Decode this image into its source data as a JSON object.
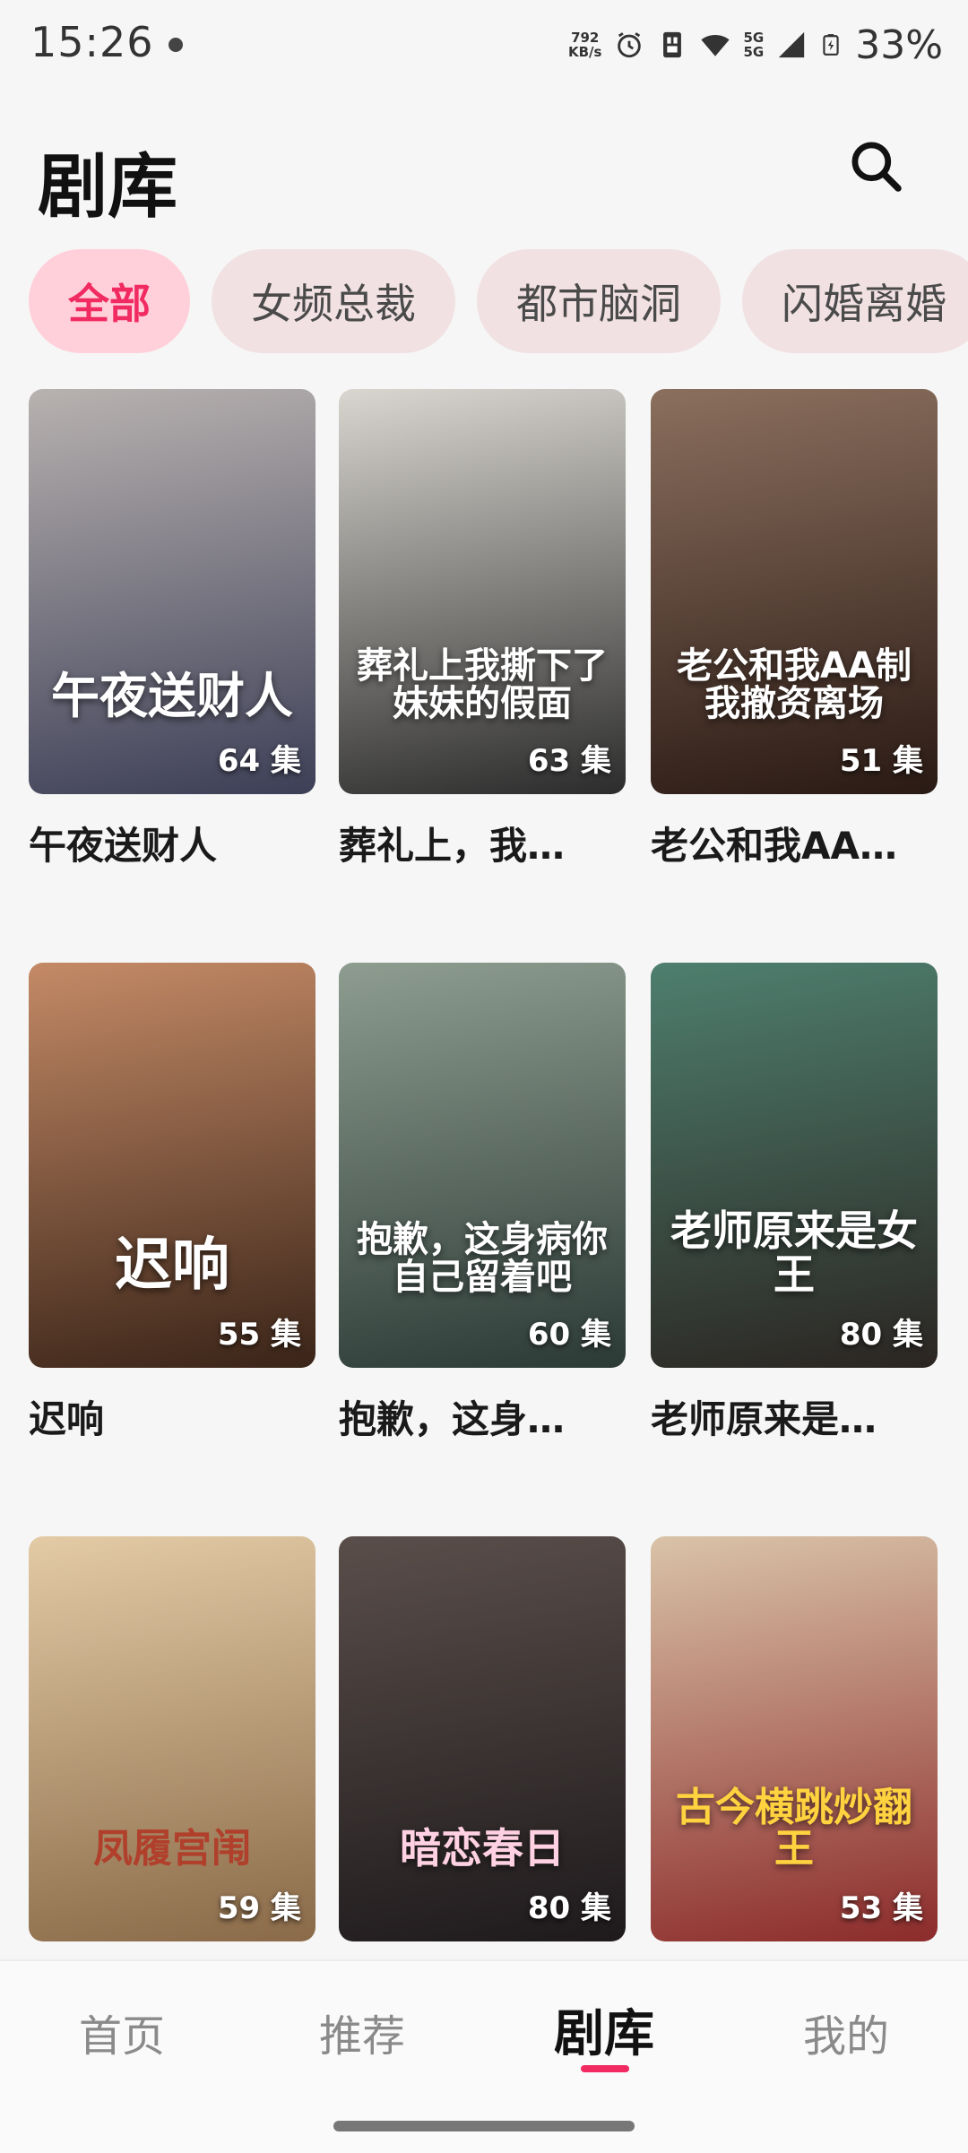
{
  "status_bar": {
    "time": "15:26",
    "net_speed": "792",
    "net_unit": "KB/s",
    "network": "5G",
    "battery": "33%"
  },
  "header": {
    "title": "剧库",
    "search_icon": "search-icon"
  },
  "chips": [
    {
      "label": "全部",
      "active": true
    },
    {
      "label": "女频总裁",
      "active": false
    },
    {
      "label": "都市脑洞",
      "active": false
    },
    {
      "label": "闪婚离婚",
      "active": false
    }
  ],
  "dramas": [
    {
      "title": "午夜送财人",
      "poster_text": "午夜送财人",
      "episodes": "64 集",
      "colors": [
        "#b8b2b0",
        "#3d3f57"
      ]
    },
    {
      "title": "葬礼上，我…",
      "poster_text": "葬礼上我撕下了妹妹的假面",
      "episodes": "63 集",
      "colors": [
        "#d9d6d0",
        "#2c2c2c"
      ]
    },
    {
      "title": "老公和我AA…",
      "poster_text": "老公和我AA制 我撤资离场",
      "episodes": "51 集",
      "colors": [
        "#8b6f5e",
        "#2a1a14"
      ]
    },
    {
      "title": "迟响",
      "poster_text": "迟响",
      "episodes": "55 集",
      "colors": [
        "#c48a66",
        "#3a2418"
      ]
    },
    {
      "title": "抱歉，这身…",
      "poster_text": "抱歉，这身病你自己留着吧",
      "episodes": "60 集",
      "colors": [
        "#8e9d90",
        "#2c3a36"
      ]
    },
    {
      "title": "老师原来是…",
      "poster_text": "老师原来是女王",
      "episodes": "80 集",
      "colors": [
        "#4e7f6e",
        "#2b2522"
      ]
    },
    {
      "title": "",
      "poster_text": "凤履宫闱",
      "episodes": "59 集",
      "colors": [
        "#e3cba6",
        "#8a6a48"
      ]
    },
    {
      "title": "",
      "poster_text": "暗恋春日",
      "episodes": "80 集",
      "colors": [
        "#5a4e4a",
        "#1e1a1c"
      ]
    },
    {
      "title": "",
      "poster_text": "古今横跳炒翻王",
      "episodes": "53 集",
      "colors": [
        "#d9c3a8",
        "#8c2b2b"
      ]
    }
  ],
  "bottom_nav": [
    {
      "label": "首页",
      "active": false
    },
    {
      "label": "推荐",
      "active": false
    },
    {
      "label": "剧库",
      "active": true
    },
    {
      "label": "我的",
      "active": false
    }
  ],
  "accent_color": "#f12b62"
}
